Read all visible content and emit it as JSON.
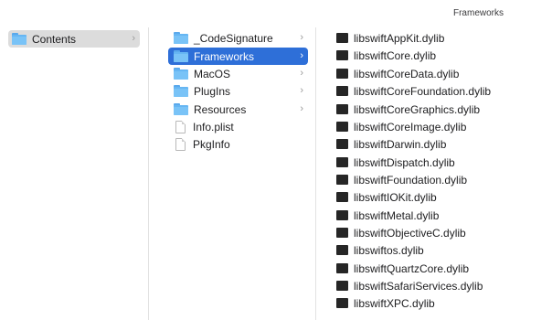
{
  "window": {
    "title": "Frameworks"
  },
  "column1": {
    "items": [
      {
        "label": "Contents",
        "icon": "folder-icon",
        "chevron": "›"
      }
    ]
  },
  "column2": {
    "items": [
      {
        "label": "_CodeSignature",
        "icon": "folder-icon",
        "chevron": "›"
      },
      {
        "label": "Frameworks",
        "icon": "folder-icon",
        "chevron": "›"
      },
      {
        "label": "MacOS",
        "icon": "folder-icon",
        "chevron": "›"
      },
      {
        "label": "PlugIns",
        "icon": "folder-icon",
        "chevron": "›"
      },
      {
        "label": "Resources",
        "icon": "folder-icon",
        "chevron": "›"
      },
      {
        "label": "Info.plist",
        "icon": "document-icon"
      },
      {
        "label": "PkgInfo",
        "icon": "document-icon"
      }
    ]
  },
  "column3": {
    "items": [
      {
        "label": "libswiftAppKit.dylib",
        "icon": "executable-icon"
      },
      {
        "label": "libswiftCore.dylib",
        "icon": "executable-icon"
      },
      {
        "label": "libswiftCoreData.dylib",
        "icon": "executable-icon"
      },
      {
        "label": "libswiftCoreFoundation.dylib",
        "icon": "executable-icon"
      },
      {
        "label": "libswiftCoreGraphics.dylib",
        "icon": "executable-icon"
      },
      {
        "label": "libswiftCoreImage.dylib",
        "icon": "executable-icon"
      },
      {
        "label": "libswiftDarwin.dylib",
        "icon": "executable-icon"
      },
      {
        "label": "libswiftDispatch.dylib",
        "icon": "executable-icon"
      },
      {
        "label": "libswiftFoundation.dylib",
        "icon": "executable-icon"
      },
      {
        "label": "libswiftIOKit.dylib",
        "icon": "executable-icon"
      },
      {
        "label": "libswiftMetal.dylib",
        "icon": "executable-icon"
      },
      {
        "label": "libswiftObjectiveC.dylib",
        "icon": "executable-icon"
      },
      {
        "label": "libswiftos.dylib",
        "icon": "executable-icon"
      },
      {
        "label": "libswiftQuartzCore.dylib",
        "icon": "executable-icon"
      },
      {
        "label": "libswiftSafariServices.dylib",
        "icon": "executable-icon"
      },
      {
        "label": "libswiftXPC.dylib",
        "icon": "executable-icon"
      }
    ]
  },
  "colors": {
    "selection_active": "#2e6fd8",
    "selection_inactive": "#dcdcdc",
    "folder": "#66b6f3"
  }
}
